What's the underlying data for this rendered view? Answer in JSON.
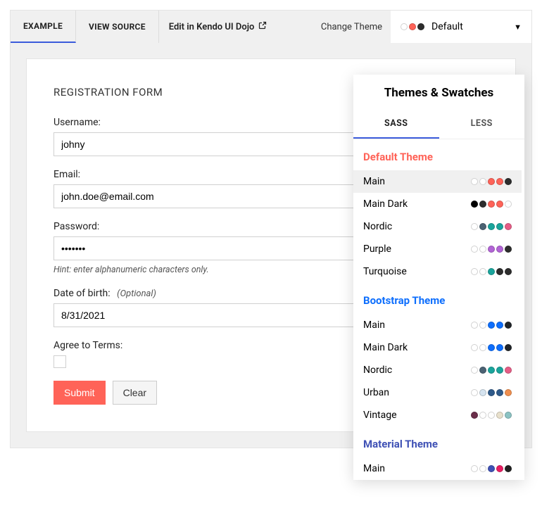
{
  "topbar": {
    "tab_example": "EXAMPLE",
    "tab_source": "VIEW SOURCE",
    "dojo_link": "Edit in Kendo UI Dojo",
    "change_theme": "Change Theme",
    "theme_selected": "Default",
    "theme_dots": [
      "#ffffff",
      "#ff6358",
      "#2d2d2d"
    ]
  },
  "form": {
    "title": "REGISTRATION FORM",
    "username_label": "Username:",
    "username_value": "johny",
    "email_label": "Email:",
    "email_value": "john.doe@email.com",
    "password_label": "Password:",
    "password_value": "•••••••",
    "password_hint": "Hint: enter alphanumeric characters only.",
    "dob_label": "Date of birth:",
    "dob_optional": "(Optional)",
    "dob_value": "8/31/2021",
    "agree_label": "Agree to Terms:",
    "submit_label": "Submit",
    "clear_label": "Clear"
  },
  "dropdown": {
    "title": "Themes & Swatches",
    "tab_sass": "SASS",
    "tab_less": "LESS",
    "groups": [
      {
        "title": "Default Theme",
        "class": "tg-default",
        "swatches": [
          {
            "name": "Main",
            "selected": true,
            "dots": [
              "#ffffff",
              "#ffffff",
              "#ff6358",
              "#ff6358",
              "#2d2d2d"
            ]
          },
          {
            "name": "Main Dark",
            "dots": [
              "#000000",
              "#2d2d2d",
              "#ff6358",
              "#ff6358",
              "#ffffff"
            ]
          },
          {
            "name": "Nordic",
            "dots": [
              "#ffffff",
              "#4b6273",
              "#1aa59c",
              "#1aa59c",
              "#e65d86"
            ]
          },
          {
            "name": "Purple",
            "dots": [
              "#ffffff",
              "#ffffff",
              "#b264d6",
              "#b264d6",
              "#2d2d2d"
            ]
          },
          {
            "name": "Turquoise",
            "dots": [
              "#ffffff",
              "#ffffff",
              "#1aa59c",
              "#2d2d2d",
              "#2d2d2d"
            ]
          }
        ]
      },
      {
        "title": "Bootstrap Theme",
        "class": "tg-bootstrap",
        "swatches": [
          {
            "name": "Main",
            "dots": [
              "#ffffff",
              "#ffffff",
              "#0d6efd",
              "#0d6efd",
              "#212529"
            ]
          },
          {
            "name": "Main Dark",
            "dots": [
              "#ffffff",
              "#ffffff",
              "#0d6efd",
              "#0d6efd",
              "#212529"
            ]
          },
          {
            "name": "Nordic",
            "dots": [
              "#ffffff",
              "#4b6273",
              "#1aa59c",
              "#1aa59c",
              "#e65d86"
            ]
          },
          {
            "name": "Urban",
            "dots": [
              "#ffffff",
              "#d6e4f0",
              "#2e5a8a",
              "#2e5a8a",
              "#f08f4f"
            ]
          },
          {
            "name": "Vintage",
            "dots": [
              "#6b2e4a",
              "#ffffff",
              "#ffffff",
              "#e8e0cc",
              "#8cc3c3"
            ]
          }
        ]
      },
      {
        "title": "Material Theme",
        "class": "tg-material",
        "swatches": [
          {
            "name": "Main",
            "dots": [
              "#ffffff",
              "#ffffff",
              "#3f51b5",
              "#e91e63",
              "#212121"
            ]
          }
        ]
      }
    ]
  }
}
